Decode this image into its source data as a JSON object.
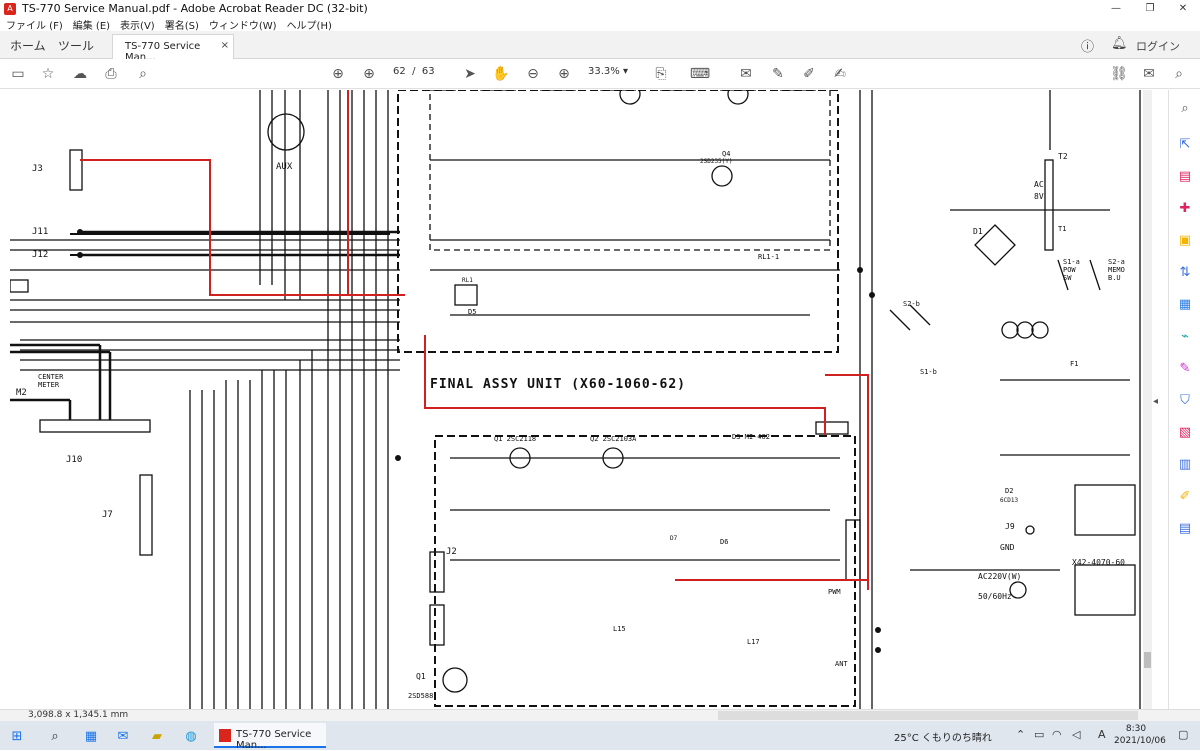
{
  "window": {
    "title": "TS-770 Service Manual.pdf - Adobe Acrobat Reader DC (32-bit)",
    "minimize_glyph": "—",
    "restore_glyph": "❐",
    "close_glyph": "✕"
  },
  "menu": [
    "ファイル (F)",
    "編集 (E)",
    "表示(V)",
    "署名(S)",
    "ウィンドウ(W)",
    "ヘルプ(H)"
  ],
  "tabs": {
    "home": "ホーム",
    "tools": "ツール",
    "document": "TS-770 Service Man...",
    "close_glyph": "×",
    "login": "ログイン"
  },
  "toolbar": {
    "page_current": "62",
    "page_separator": "/",
    "page_total": "63",
    "zoom": "33.3%"
  },
  "schematic": {
    "title_label": "FINAL  ASSY  UNIT   (X60-1060-62)",
    "labels": {
      "aux": "AUX",
      "j3": "J3",
      "j11": "J11",
      "j12": "J12",
      "j10": "J10",
      "j7": "J7",
      "j2": "J2",
      "m2": "M2",
      "center_meter": "CENTER\nMETER",
      "q1": "Q1",
      "q1_part": "2SD588",
      "ac": "AC",
      "ac_volt": "8V",
      "t2": "T2",
      "t1": "T1",
      "d1": "D1",
      "d2": "D2",
      "d2_part": "6CD13",
      "s1b": "S1-b",
      "s2b": "S2-b",
      "s1a": "S1-a\nPOW\nSW",
      "s2a": "S2-a\nMEMO\nB.U",
      "f1": "F1",
      "j9": "J9",
      "gnd": "GND",
      "ac220": "AC220V(W)",
      "hz": "50/60Hz",
      "x42": "X42-4070-60",
      "rl1": "RL1-1",
      "q4": "Q4",
      "q4_part": "2SD235(Y)",
      "q1b": "Q1 2SC2118",
      "q2": "Q2 2SC2103A",
      "d3": "D3 MI-402",
      "d6": "D6",
      "d7": "D7",
      "d5": "D5",
      "rl1b": "RL1",
      "l15": "L15",
      "l17": "L17",
      "ant": "ANT",
      "pwm": "PWM"
    }
  },
  "status": {
    "dimensions": "3,098.8 x 1,345.1 mm"
  },
  "taskbar": {
    "task_label": "TS-770 Service Man...",
    "weather": "25°C くもりのち晴れ",
    "ime": "A",
    "time": "8:30",
    "date": "2021/10/06"
  }
}
